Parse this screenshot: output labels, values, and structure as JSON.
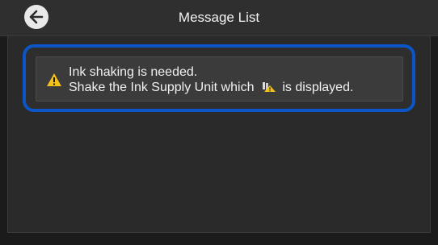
{
  "header": {
    "title": "Message List"
  },
  "messages": [
    {
      "line1": "Ink shaking is needed.",
      "line2_prefix": "Shake the Ink Supply Unit which",
      "line2_suffix": "is displayed."
    }
  ],
  "colors": {
    "highlight": "#0b55c7",
    "warning": "#f2c21b"
  },
  "icons": {
    "back": "back-arrow-icon",
    "warning": "warning-icon",
    "ink_shaking": "ink-shake-icon"
  }
}
